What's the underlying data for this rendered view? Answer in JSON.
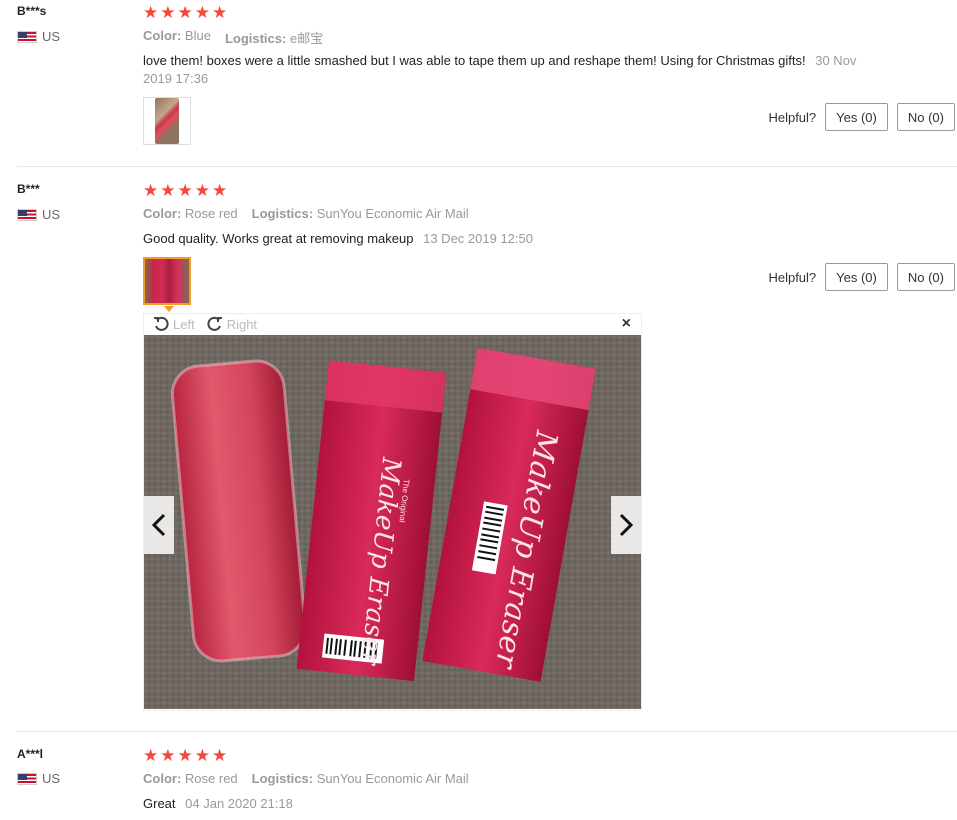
{
  "reviews": [
    {
      "user": "B***s",
      "country": "US",
      "rating": 5,
      "color_label": "Color:",
      "color_value": "Blue",
      "logistics_label": "Logistics:",
      "logistics_value": "e邮宝",
      "text": "love them! boxes were a little smashed but I was able to tape them up and reshape them! Using for Christmas gifts!",
      "date": "30 Nov 2019 17:36",
      "helpful_label": "Helpful?",
      "yes_label": "Yes (0)",
      "no_label": "No (0)"
    },
    {
      "user": "B***",
      "country": "US",
      "rating": 5,
      "color_label": "Color:",
      "color_value": "Rose red",
      "logistics_label": "Logistics:",
      "logistics_value": "SunYou Economic Air Mail",
      "text": "Good quality. Works great at removing makeup",
      "date": "13 Dec 2019 12:50",
      "helpful_label": "Helpful?",
      "yes_label": "Yes (0)",
      "no_label": "No (0)"
    },
    {
      "user": "A***l",
      "country": "US",
      "rating": 5,
      "color_label": "Color:",
      "color_value": "Rose red",
      "logistics_label": "Logistics:",
      "logistics_value": "SunYou Economic Air Mail",
      "text": "Great",
      "date": "04 Jan 2020 21:18"
    }
  ],
  "viewer": {
    "rotate_left": "Left",
    "rotate_right": "Right",
    "close": "×",
    "photo_text": {
      "brand_small": "The Original",
      "brand_script": "MakeUp Eraser",
      "brand_script_short": "MakeUp Eraser"
    }
  },
  "colors": {
    "star": "#f5483b",
    "active_thumb_border": "#f59a23",
    "product_pink": "#d1264f"
  },
  "icons": {
    "star": "star-icon",
    "flag": "us-flag-icon",
    "rotate_left": "rotate-left-icon",
    "rotate_right": "rotate-right-icon",
    "prev": "chevron-left-icon",
    "next": "chevron-right-icon",
    "close": "close-icon"
  }
}
